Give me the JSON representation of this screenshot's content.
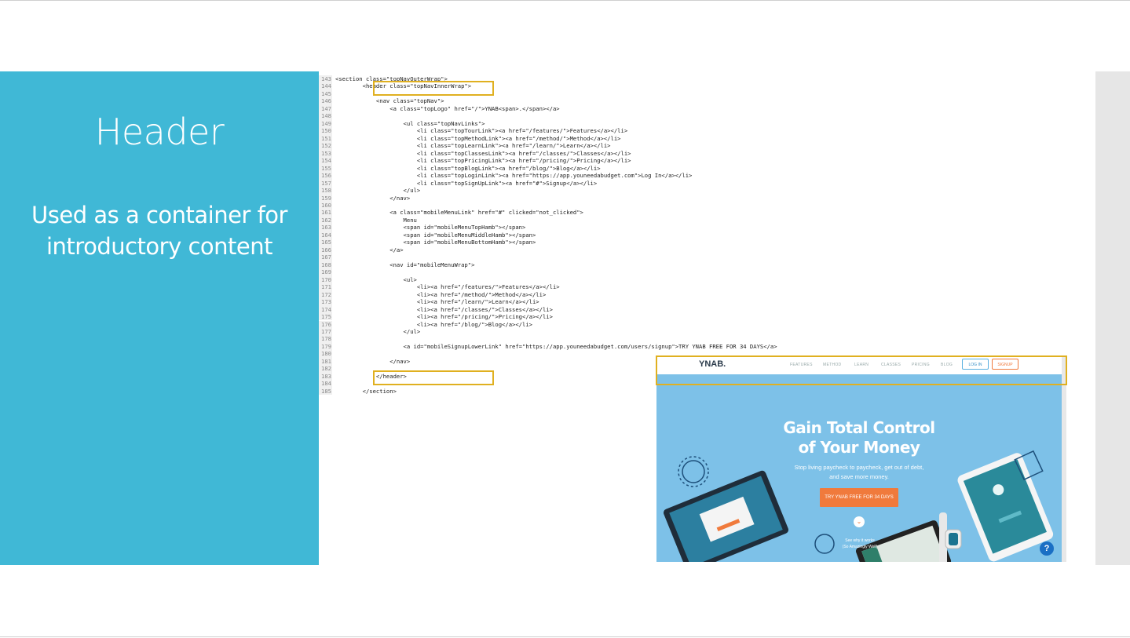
{
  "slide": {
    "title": "Header",
    "subtitle_line1": "Used as a container for",
    "subtitle_line2": "introductory content"
  },
  "code": {
    "lines": [
      {
        "n": "143",
        "t": "<section class=\"topNavOuterWrap\">"
      },
      {
        "n": "144",
        "t": "        <header class=\"topNavInnerWrap\">"
      },
      {
        "n": "145",
        "t": ""
      },
      {
        "n": "146",
        "t": "            <nav class=\"topNav\">"
      },
      {
        "n": "147",
        "t": "                <a class=\"topLogo\" href=\"/\">YNAB<span>.</span></a>"
      },
      {
        "n": "148",
        "t": ""
      },
      {
        "n": "149",
        "t": "                    <ul class=\"topNavLinks\">"
      },
      {
        "n": "150",
        "t": "                        <li class=\"topTourLink\"><a href=\"/features/\">Features</a></li>"
      },
      {
        "n": "151",
        "t": "                        <li class=\"topMethodLink\"><a href=\"/method/\">Method</a></li>"
      },
      {
        "n": "152",
        "t": "                        <li class=\"topLearnLink\"><a href=\"/learn/\">Learn</a></li>"
      },
      {
        "n": "153",
        "t": "                        <li class=\"topClassesLink\"><a href=\"/classes/\">Classes</a></li>"
      },
      {
        "n": "154",
        "t": "                        <li class=\"topPricingLink\"><a href=\"/pricing/\">Pricing</a></li>"
      },
      {
        "n": "155",
        "t": "                        <li class=\"topBlogLink\"><a href=\"/blog/\">Blog</a></li>"
      },
      {
        "n": "156",
        "t": "                        <li class=\"topLoginLink\"><a href=\"https://app.youneedabudget.com\">Log In</a></li>"
      },
      {
        "n": "157",
        "t": "                        <li class=\"topSignUpLink\"><a href=\"#\">Signup</a></li>"
      },
      {
        "n": "158",
        "t": "                    </ul>"
      },
      {
        "n": "159",
        "t": "                </nav>"
      },
      {
        "n": "160",
        "t": ""
      },
      {
        "n": "161",
        "t": "                <a class=\"mobileMenuLink\" href=\"#\" clicked=\"not_clicked\">"
      },
      {
        "n": "162",
        "t": "                    Menu"
      },
      {
        "n": "163",
        "t": "                    <span id=\"mobileMenuTopHamb\"></span>"
      },
      {
        "n": "164",
        "t": "                    <span id=\"mobileMenuMiddleHamb\"></span>"
      },
      {
        "n": "165",
        "t": "                    <span id=\"mobileMenuBottomHamb\"></span>"
      },
      {
        "n": "166",
        "t": "                </a>"
      },
      {
        "n": "167",
        "t": ""
      },
      {
        "n": "168",
        "t": "                <nav id=\"mobileMenuWrap\">"
      },
      {
        "n": "169",
        "t": ""
      },
      {
        "n": "170",
        "t": "                    <ul>"
      },
      {
        "n": "171",
        "t": "                        <li><a href=\"/features/\">Features</a></li>"
      },
      {
        "n": "172",
        "t": "                        <li><a href=\"/method/\">Method</a></li>"
      },
      {
        "n": "173",
        "t": "                        <li><a href=\"/learn/\">Learn</a></li>"
      },
      {
        "n": "174",
        "t": "                        <li><a href=\"/classes/\">Classes</a></li>"
      },
      {
        "n": "175",
        "t": "                        <li><a href=\"/pricing/\">Pricing</a></li>"
      },
      {
        "n": "176",
        "t": "                        <li><a href=\"/blog/\">Blog</a></li>"
      },
      {
        "n": "177",
        "t": "                    </ul>"
      },
      {
        "n": "178",
        "t": ""
      },
      {
        "n": "179",
        "t": "                    <a id=\"mobileSignupLowerLink\" href=\"https://app.youneedabudget.com/users/signup\">TRY YNAB FREE FOR 34 DAYS</a>"
      },
      {
        "n": "180",
        "t": ""
      },
      {
        "n": "181",
        "t": "                </nav>"
      },
      {
        "n": "182",
        "t": ""
      },
      {
        "n": "183",
        "t": "            </header>"
      },
      {
        "n": "184",
        "t": ""
      },
      {
        "n": "185",
        "t": "        </section>"
      }
    ]
  },
  "ynab": {
    "logo": "YNAB.",
    "nav": [
      "FEATURES",
      "METHOD",
      "LEARN",
      "CLASSES",
      "PRICING",
      "BLOG"
    ],
    "login": "LOG IN",
    "signup": "SIGNUP",
    "hero_title_1": "Gain Total Control",
    "hero_title_2": "of Your Money",
    "hero_sub_1": "Stop living paycheck to paycheck, get out of debt,",
    "hero_sub_2": "and save more money.",
    "cta": "TRY YNAB FREE FOR 34 DAYS",
    "see_1": "See why it works",
    "see_2": "(So Amazingly Well)",
    "help": "?"
  },
  "colors": {
    "panel": "#40b8d6",
    "highlight": "#e0b020",
    "cta": "#f07a3c"
  }
}
